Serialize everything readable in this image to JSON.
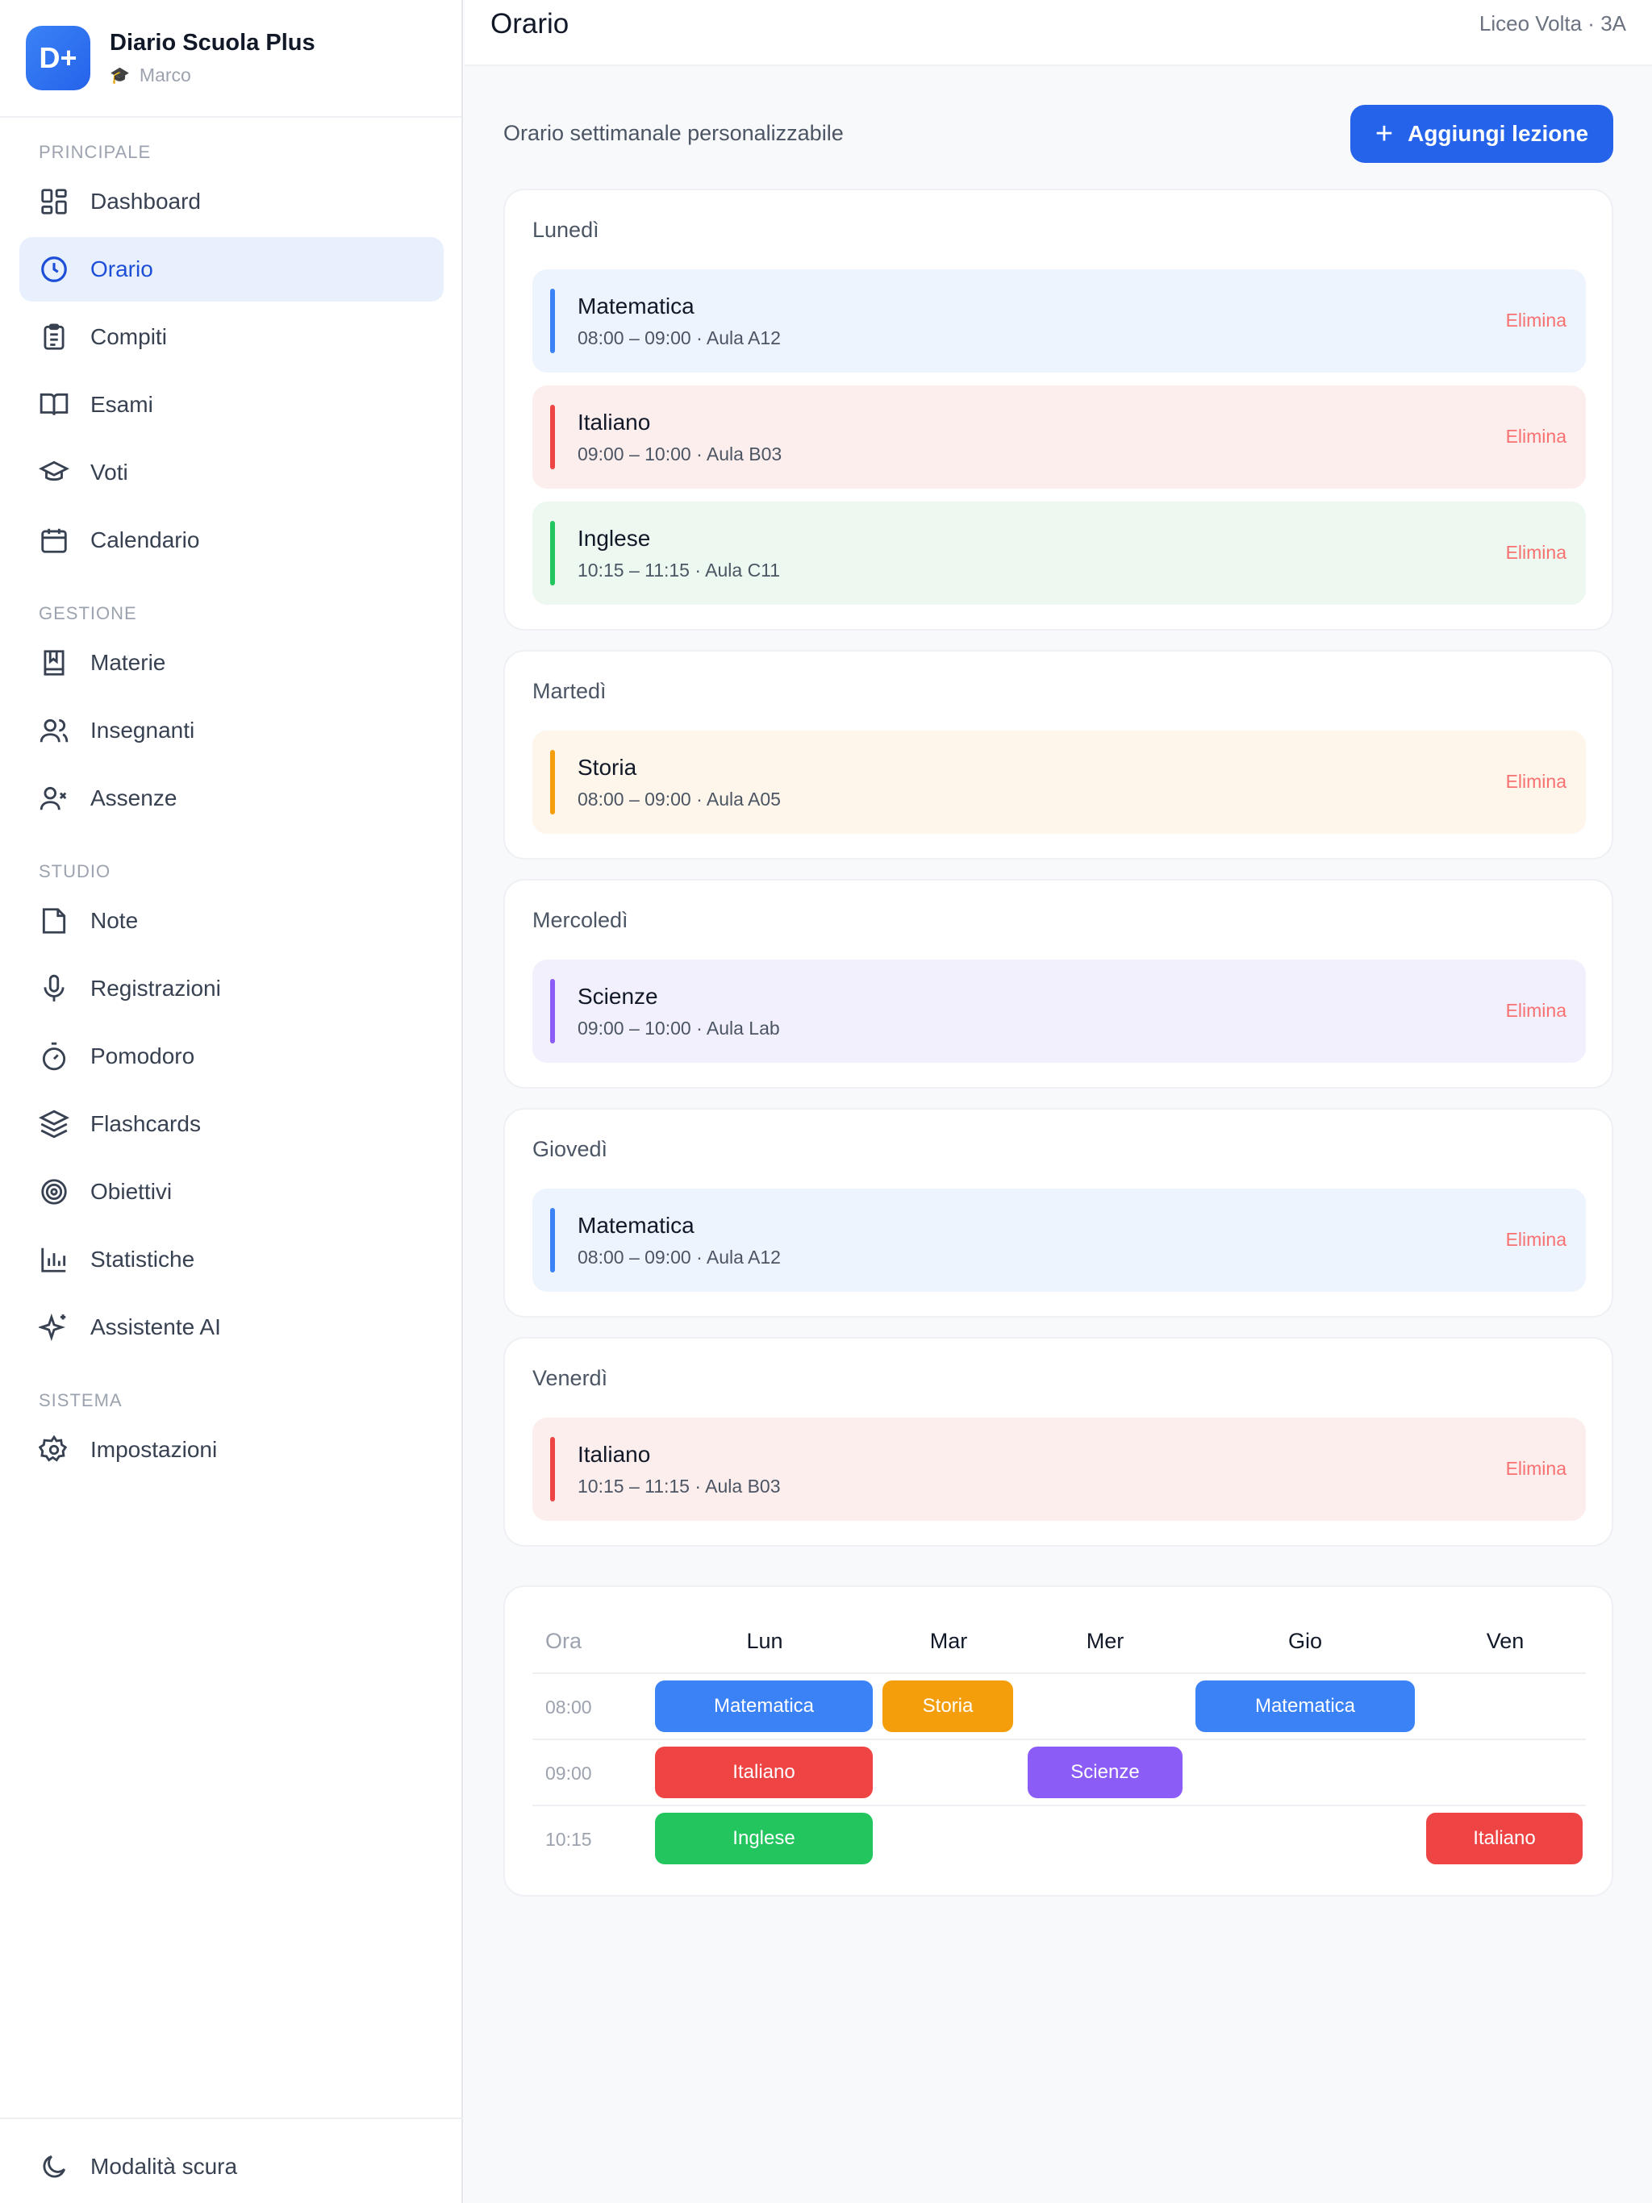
{
  "brand": {
    "logo": "D+",
    "title": "Diario Scuola Plus",
    "user": "Marco",
    "user_icon": "graduation-cap-icon"
  },
  "sidebar": {
    "sections": {
      "principale": "PRINCIPALE",
      "gestione": "GESTIONE",
      "studio": "STUDIO",
      "sistema": "SISTEMA"
    },
    "items": [
      {
        "label": "Dashboard",
        "icon": "dashboard-icon"
      },
      {
        "label": "Orario",
        "icon": "clock-icon",
        "active": true
      },
      {
        "label": "Compiti",
        "icon": "clipboard-icon"
      },
      {
        "label": "Esami",
        "icon": "book-open-icon"
      },
      {
        "label": "Voti",
        "icon": "graduation-cap-icon"
      },
      {
        "label": "Calendario",
        "icon": "calendar-icon"
      },
      {
        "label": "Materie",
        "icon": "book-icon"
      },
      {
        "label": "Insegnanti",
        "icon": "users-icon"
      },
      {
        "label": "Assenze",
        "icon": "user-x-icon"
      },
      {
        "label": "Note",
        "icon": "note-icon"
      },
      {
        "label": "Registrazioni",
        "icon": "mic-icon"
      },
      {
        "label": "Pomodoro",
        "icon": "timer-icon"
      },
      {
        "label": "Flashcards",
        "icon": "layers-icon"
      },
      {
        "label": "Obiettivi",
        "icon": "target-icon"
      },
      {
        "label": "Statistiche",
        "icon": "bar-chart-icon"
      },
      {
        "label": "Assistente AI",
        "icon": "sparkles-icon"
      },
      {
        "label": "Impostazioni",
        "icon": "gear-icon"
      }
    ],
    "dark_mode": "Modalità scura"
  },
  "header": {
    "title": "Orario",
    "school": "Liceo Volta · 3A"
  },
  "main": {
    "subtitle": "Orario settimanale personalizzabile",
    "add_button": "Aggiungi lezione",
    "delete_label": "Elimina",
    "days": [
      {
        "name": "Lunedì",
        "lessons": [
          {
            "subject": "Matematica",
            "meta": "08:00 – 09:00 · Aula A12"
          },
          {
            "subject": "Italiano",
            "meta": "09:00 – 10:00 · Aula B03"
          },
          {
            "subject": "Inglese",
            "meta": "10:15 – 11:15 · Aula C11"
          }
        ]
      },
      {
        "name": "Martedì",
        "lessons": [
          {
            "subject": "Storia",
            "meta": "08:00 – 09:00 · Aula A05"
          }
        ]
      },
      {
        "name": "Mercoledì",
        "lessons": [
          {
            "subject": "Scienze",
            "meta": "09:00 – 10:00 · Aula Lab"
          }
        ]
      },
      {
        "name": "Giovedì",
        "lessons": [
          {
            "subject": "Matematica",
            "meta": "08:00 – 09:00 · Aula A12"
          }
        ]
      },
      {
        "name": "Venerdì",
        "lessons": [
          {
            "subject": "Italiano",
            "meta": "10:15 – 11:15 · Aula B03"
          }
        ]
      }
    ]
  },
  "grid": {
    "ora_label": "Ora",
    "columns": [
      "Lun",
      "Mar",
      "Mer",
      "Gio",
      "Ven"
    ],
    "times": [
      "08:00",
      "09:00",
      "10:15"
    ],
    "cells": [
      [
        "Matematica",
        "Storia",
        "",
        "Matematica",
        ""
      ],
      [
        "Italiano",
        "",
        "Scienze",
        "",
        ""
      ],
      [
        "Inglese",
        "",
        "",
        "",
        "Italiano"
      ]
    ]
  },
  "colors": {
    "Matematica": "#3b82f6",
    "Italiano": "#ef4444",
    "Inglese": "#22c55e",
    "Storia": "#f59e0b",
    "Scienze": "#8b5cf6",
    "accent": "#2563eb"
  }
}
